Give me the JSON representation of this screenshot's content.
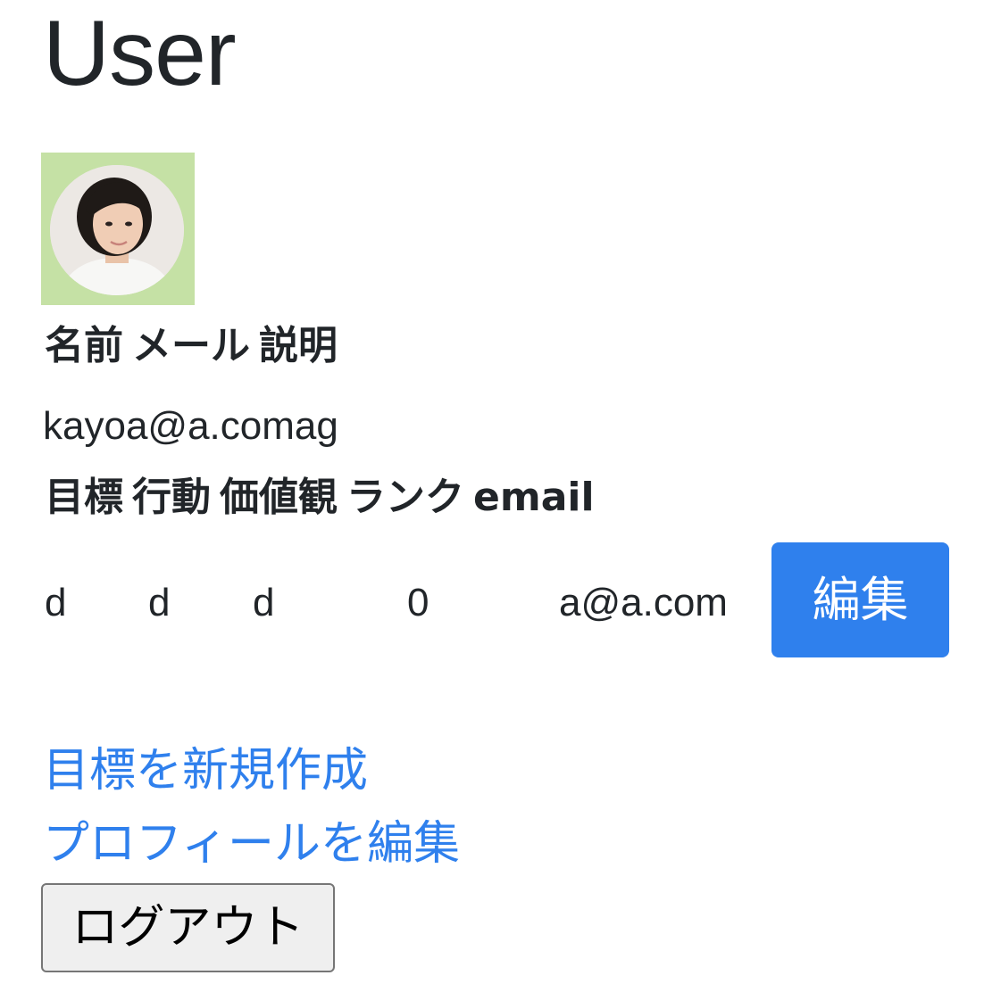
{
  "page": {
    "title": "User"
  },
  "profile": {
    "header_labels": [
      "名前",
      "メール",
      "説明"
    ],
    "values": "kayoa@a.comag"
  },
  "goal_table": {
    "headers": [
      "目標",
      "行動",
      "価値観",
      "ランク",
      "email"
    ],
    "rows": [
      {
        "goal": "d",
        "action": "d",
        "values": "d",
        "rank": "0",
        "email": "a@a.com",
        "edit_label": "編集"
      }
    ]
  },
  "links": {
    "new_goal": "目標を新規作成",
    "edit_profile": "プロフィールを編集"
  },
  "logout_label": "ログアウト",
  "colors": {
    "accent": "#2f80ed",
    "avatar_background": "#c5e1a5"
  }
}
